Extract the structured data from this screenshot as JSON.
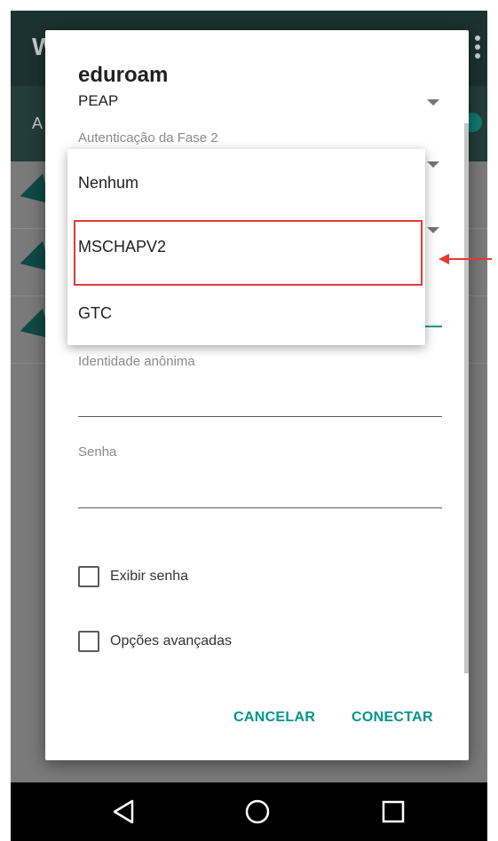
{
  "background": {
    "toolbar_letter": "W",
    "subbar_letter": "A"
  },
  "dialog": {
    "title": "eduroam",
    "eap_method": "PEAP",
    "phase2_label": "Autenticação da Fase 2",
    "anonymous_identity_label": "Identidade anônima",
    "password_label": "Senha",
    "show_password_label": "Exibir senha",
    "advanced_options_label": "Opções avançadas",
    "cancel_label": "CANCELAR",
    "connect_label": "CONECTAR"
  },
  "dropdown": {
    "options": [
      "Nenhum",
      "MSCHAPV2",
      "GTC"
    ],
    "highlighted": "MSCHAPV2"
  },
  "colors": {
    "accent": "#009688",
    "annotation": "#e53935"
  },
  "icons": {
    "nav": [
      "back-icon",
      "home-icon",
      "recents-icon"
    ]
  }
}
